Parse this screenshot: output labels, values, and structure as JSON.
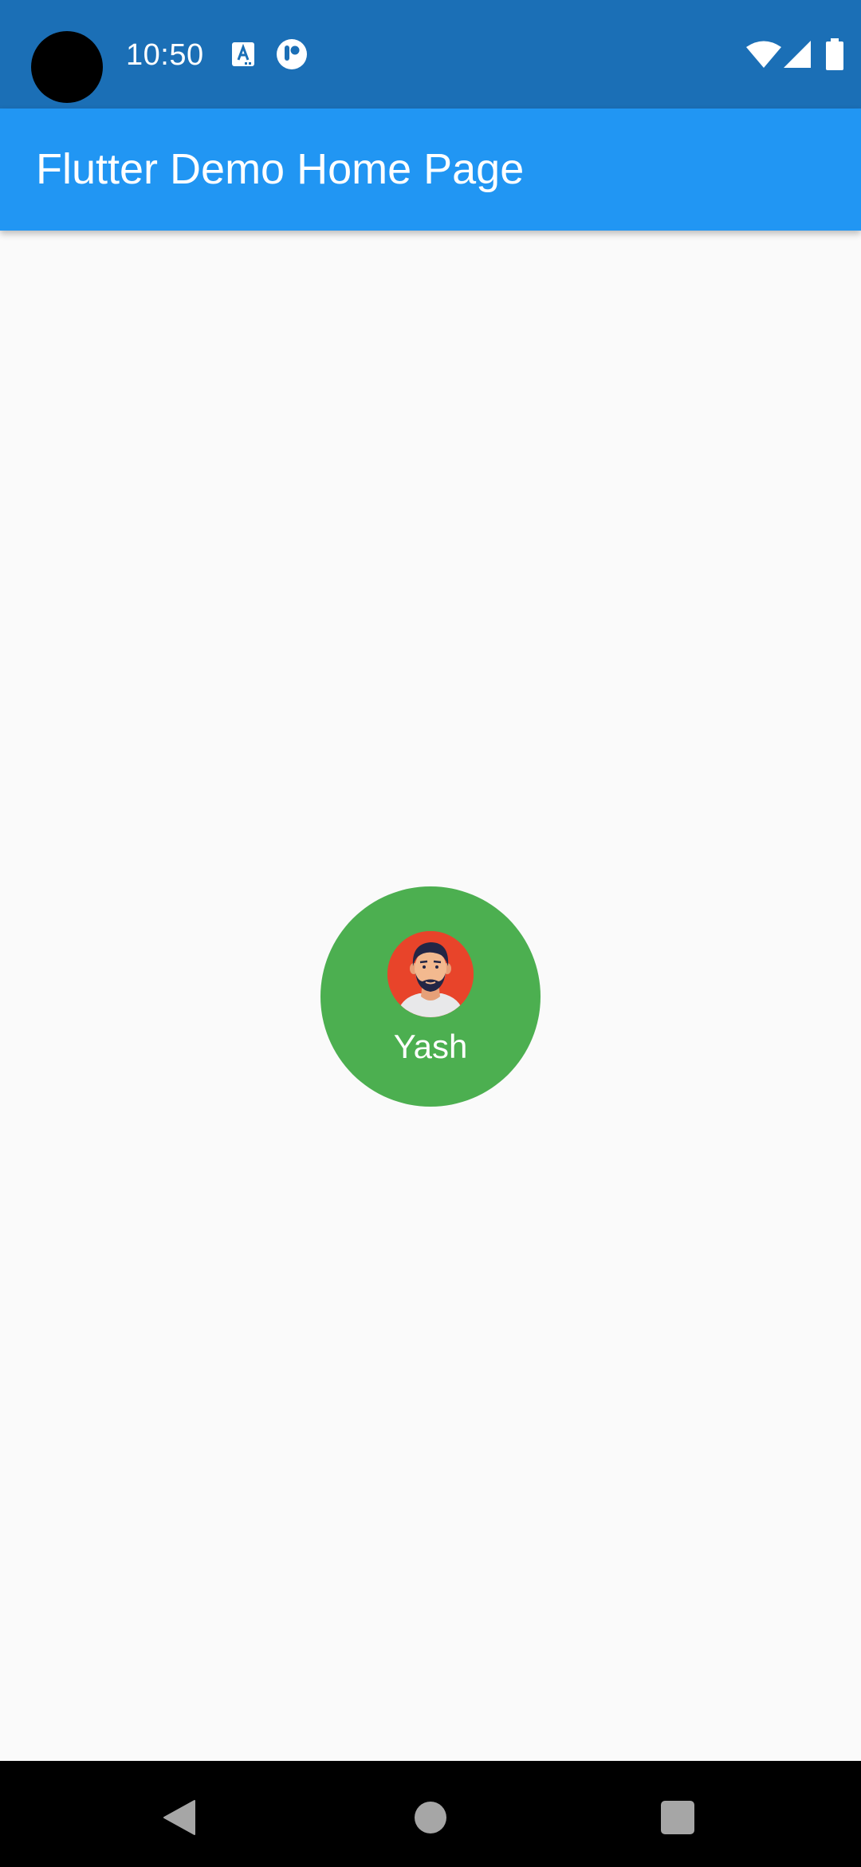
{
  "status_bar": {
    "time": "10:50",
    "icons": [
      "camera-cutout",
      "text-a-icon",
      "pocket-icon",
      "wifi-icon",
      "cell-signal-icon",
      "battery-icon"
    ],
    "background_color": "#1b6fb6"
  },
  "app_bar": {
    "title": "Flutter Demo Home Page",
    "background_color": "#2196f3"
  },
  "profile": {
    "name": "Yash",
    "avatar_icon": "man-avatar-icon",
    "circle_color": "#4caf50",
    "avatar_background": "#e8442a"
  },
  "navigation_bar": {
    "buttons": [
      "back-icon",
      "home-icon",
      "recents-icon"
    ],
    "background_color": "#000000"
  }
}
